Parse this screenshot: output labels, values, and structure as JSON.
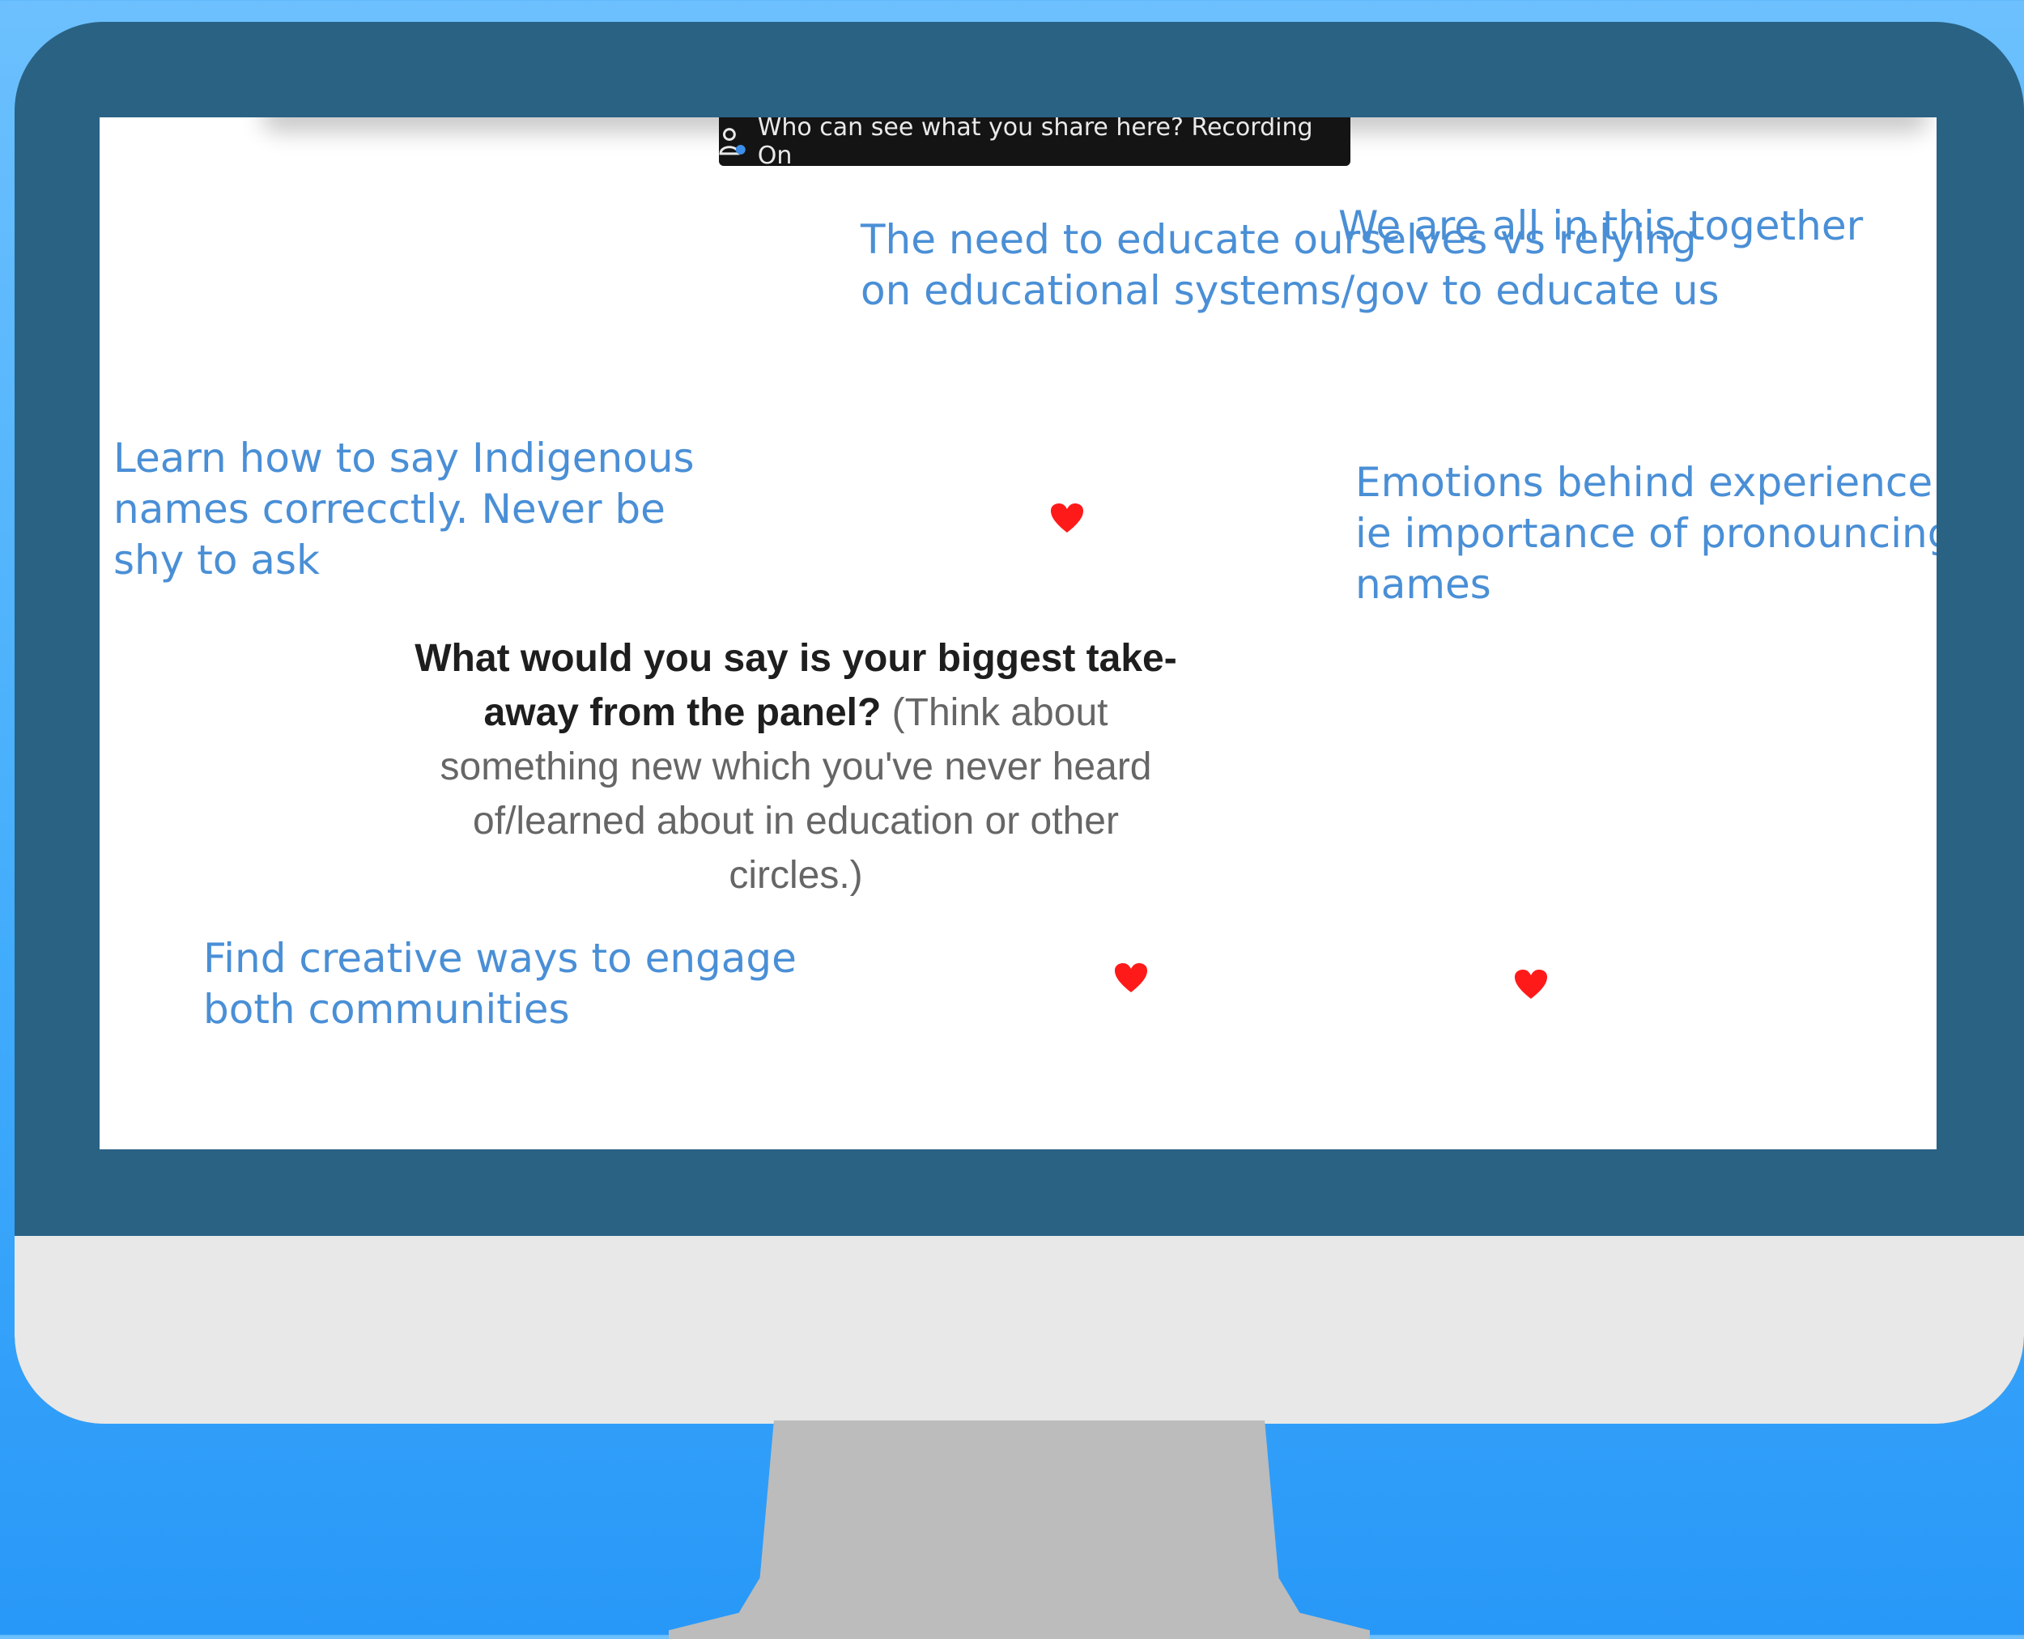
{
  "banner": {
    "text": "Who can see what you share here? Recording On",
    "icon": "person-icon"
  },
  "board": {
    "prompt_bold": "What would you say is your biggest take-away from the panel?",
    "prompt_rest": "(Think about something new which you've never heard of/learned about in education or other circles.)",
    "notes": [
      "The need to educate ourselves vs relying on educational systems/gov to educate us",
      "We are all in this together",
      "Learn how to say Indigenous names correcctly. Never be shy to ask",
      "Emotions behind experience - ie importance of pronouncing names",
      "Find creative ways to engage both communities"
    ],
    "heart_color": "#ff1a1a",
    "heart_icon": "heart-icon",
    "note_color": "#4a8fd6"
  },
  "colors": {
    "background": "#44aefc",
    "monitor_bezel": "#2a6284",
    "monitor_chin": "#e8e8e8",
    "stand": "#bcbcbc"
  }
}
